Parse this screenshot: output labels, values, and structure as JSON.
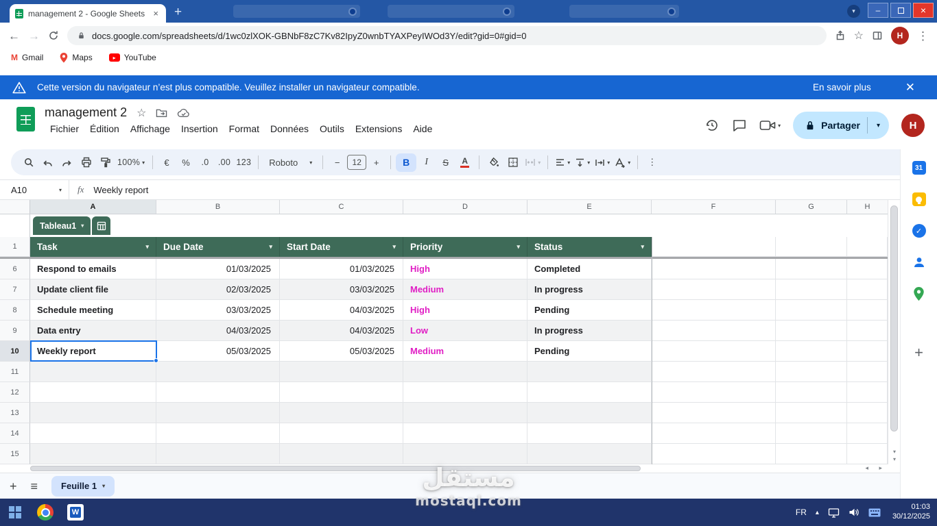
{
  "browser": {
    "tab_title": "management 2 - Google Sheets",
    "url": "docs.google.com/spreadsheets/d/1wc0zlXOK-GBNbF8zC7Kv82IpyZ0wnbTYAXPeyIWOd3Y/edit?gid=0#gid=0",
    "bookmarks": [
      "Gmail",
      "Maps",
      "YouTube"
    ],
    "avatar_letter": "H"
  },
  "banner": {
    "text": "Cette version du navigateur n’est plus compatible. Veuillez installer un navigateur compatible.",
    "link": "En savoir plus"
  },
  "header": {
    "title": "management 2",
    "menus": [
      "Fichier",
      "Édition",
      "Affichage",
      "Insertion",
      "Format",
      "Données",
      "Outils",
      "Extensions",
      "Aide"
    ],
    "share": "Partager",
    "avatar_letter": "H"
  },
  "toolbar": {
    "zoom": "100%",
    "euro": "€",
    "percent": "%",
    "dec_dec": ".0",
    "dec_inc": ".00",
    "num_fmt": "123",
    "font": "Roboto",
    "size": "12",
    "bold": "B",
    "italic": "I",
    "strike": "S",
    "color": "A"
  },
  "formula": {
    "ref": "A10",
    "fx": "fx",
    "value": "Weekly report"
  },
  "grid": {
    "cols": [
      "A",
      "B",
      "C",
      "D",
      "E",
      "F",
      "G",
      "H"
    ],
    "table_name": "Tableau1",
    "header_row": {
      "n": "1",
      "cells": [
        "Task",
        "Due Date",
        "Start Date",
        "Priority",
        "Status"
      ]
    },
    "rows": [
      {
        "n": "6",
        "task": "Respond to emails",
        "due": "01/03/2025",
        "start": "01/03/2025",
        "priority": "High",
        "status": "Completed"
      },
      {
        "n": "7",
        "task": "Update client file",
        "due": "02/03/2025",
        "start": "03/03/2025",
        "priority": "Medium",
        "status": "In progress"
      },
      {
        "n": "8",
        "task": "Schedule meeting",
        "due": "03/03/2025",
        "start": "04/03/2025",
        "priority": "High",
        "status": "Pending"
      },
      {
        "n": "9",
        "task": "Data entry",
        "due": "04/03/2025",
        "start": "04/03/2025",
        "priority": "Low",
        "status": "In progress"
      },
      {
        "n": "10",
        "task": "Weekly report",
        "due": "05/03/2025",
        "start": "05/03/2025",
        "priority": "Medium",
        "status": "Pending"
      }
    ],
    "empty_rows": [
      "11",
      "12",
      "13",
      "14",
      "15"
    ]
  },
  "sidepanel": {
    "calendar_day": "31"
  },
  "sheetbar": {
    "sheet": "Feuille 1"
  },
  "watermark": {
    "arabic": "مستقل",
    "latin": "mostaql.com"
  },
  "taskbar": {
    "lang": "FR",
    "time": "01:03",
    "date": "30/12/2025"
  },
  "colors": {
    "accent_blue": "#1a73e8",
    "table_green": "#3e6b58",
    "priority_magenta": "#e01ec4"
  }
}
